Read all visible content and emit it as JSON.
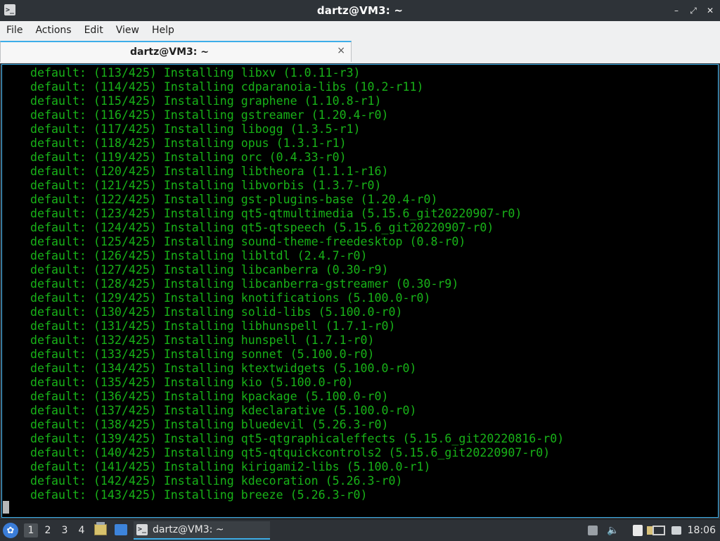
{
  "window": {
    "title": "dartz@VM3: ~",
    "icon": "terminal-icon",
    "controls": {
      "minimize": "–",
      "maximize": "⤢",
      "close": "✕"
    }
  },
  "menu": {
    "items": [
      "File",
      "Actions",
      "Edit",
      "View",
      "Help"
    ]
  },
  "tabs": [
    {
      "label": "dartz@VM3: ~",
      "close": "×"
    }
  ],
  "terminal": {
    "text_color": "#18b218",
    "lines": [
      "default: (113/425) Installing libxv (1.0.11-r3)",
      "default: (114/425) Installing cdparanoia-libs (10.2-r11)",
      "default: (115/425) Installing graphene (1.10.8-r1)",
      "default: (116/425) Installing gstreamer (1.20.4-r0)",
      "default: (117/425) Installing libogg (1.3.5-r1)",
      "default: (118/425) Installing opus (1.3.1-r1)",
      "default: (119/425) Installing orc (0.4.33-r0)",
      "default: (120/425) Installing libtheora (1.1.1-r16)",
      "default: (121/425) Installing libvorbis (1.3.7-r0)",
      "default: (122/425) Installing gst-plugins-base (1.20.4-r0)",
      "default: (123/425) Installing qt5-qtmultimedia (5.15.6_git20220907-r0)",
      "default: (124/425) Installing qt5-qtspeech (5.15.6_git20220907-r0)",
      "default: (125/425) Installing sound-theme-freedesktop (0.8-r0)",
      "default: (126/425) Installing libltdl (2.4.7-r0)",
      "default: (127/425) Installing libcanberra (0.30-r9)",
      "default: (128/425) Installing libcanberra-gstreamer (0.30-r9)",
      "default: (129/425) Installing knotifications (5.100.0-r0)",
      "default: (130/425) Installing solid-libs (5.100.0-r0)",
      "default: (131/425) Installing libhunspell (1.7.1-r0)",
      "default: (132/425) Installing hunspell (1.7.1-r0)",
      "default: (133/425) Installing sonnet (5.100.0-r0)",
      "default: (134/425) Installing ktextwidgets (5.100.0-r0)",
      "default: (135/425) Installing kio (5.100.0-r0)",
      "default: (136/425) Installing kpackage (5.100.0-r0)",
      "default: (137/425) Installing kdeclarative (5.100.0-r0)",
      "default: (138/425) Installing bluedevil (5.26.3-r0)",
      "default: (139/425) Installing qt5-qtgraphicaleffects (5.15.6_git20220816-r0)",
      "default: (140/425) Installing qt5-qtquickcontrols2 (5.15.6_git20220907-r0)",
      "default: (141/425) Installing kirigami2-libs (5.100.0-r1)",
      "default: (142/425) Installing kdecoration (5.26.3-r0)",
      "default: (143/425) Installing breeze (5.26.3-r0)"
    ]
  },
  "taskbar": {
    "start_icon": "start-menu-icon",
    "desktops": [
      "1",
      "2",
      "3",
      "4"
    ],
    "active_desktop": "1",
    "launchers": [
      "file-manager-icon",
      "show-desktop-icon"
    ],
    "task": {
      "label": "dartz@VM3: ~",
      "icon": "terminal-icon"
    },
    "tray_icons": [
      "update-notifier-icon",
      "volume-icon",
      "clipboard-icon",
      "screenshot-icon",
      "network-icon"
    ],
    "clock": "18:06",
    "accent": "#3daee9"
  }
}
